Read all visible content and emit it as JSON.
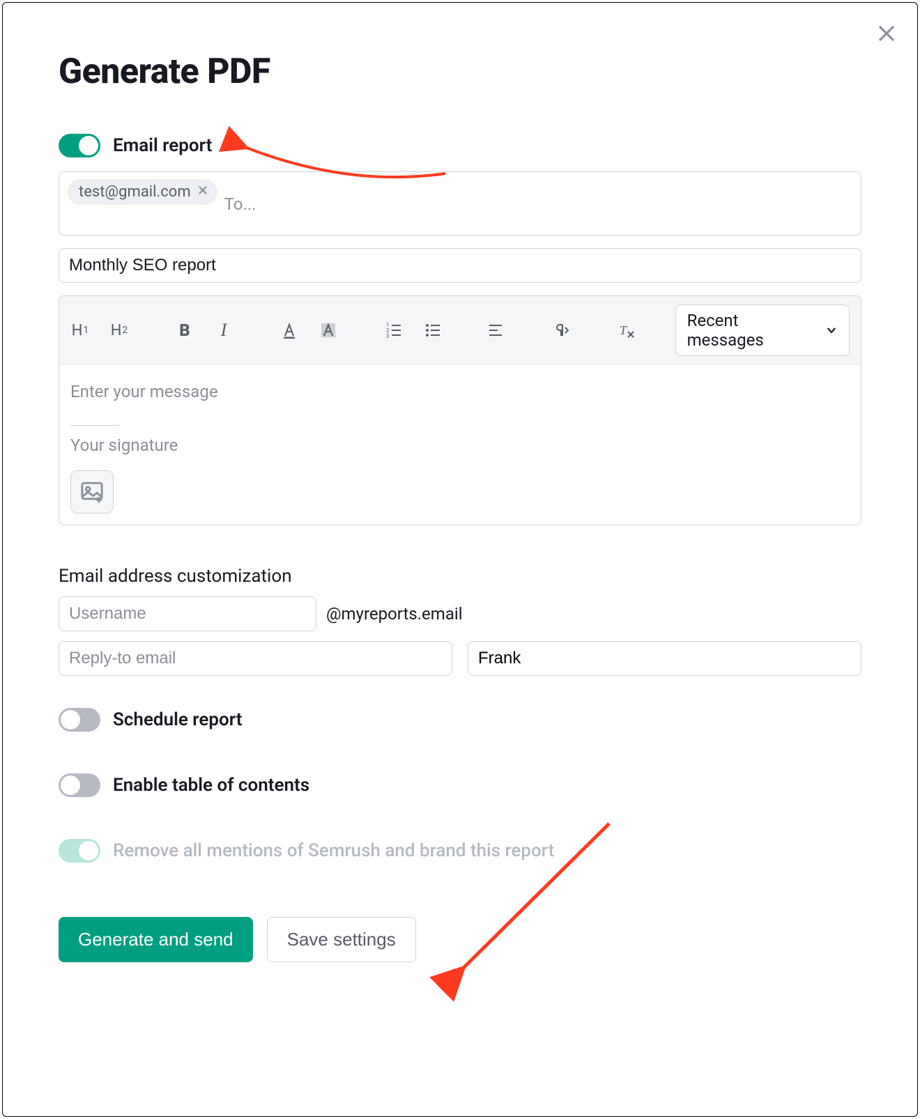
{
  "title": "Generate PDF",
  "emailReport": {
    "toggle_label": "Email report",
    "toggle_on": true,
    "chips": [
      "test@gmail.com"
    ],
    "to_placeholder": "To...",
    "subject_value": "Monthly SEO report"
  },
  "editor": {
    "recent_label": "Recent messages",
    "body_placeholder": "Enter your message",
    "signature_placeholder": "Your signature"
  },
  "emailCustomization": {
    "section_label": "Email address customization",
    "username_placeholder": "Username",
    "domain_suffix": "@myreports.email",
    "reply_to_placeholder": "Reply-to email",
    "name_value": "Frank"
  },
  "toggles": {
    "schedule_label": "Schedule report",
    "schedule_on": false,
    "toc_label": "Enable table of contents",
    "toc_on": false,
    "remove_brand_label": "Remove all mentions of Semrush and brand this report",
    "remove_brand_on": true,
    "remove_brand_disabled": true
  },
  "actions": {
    "primary_label": "Generate and send",
    "secondary_label": "Save settings"
  }
}
